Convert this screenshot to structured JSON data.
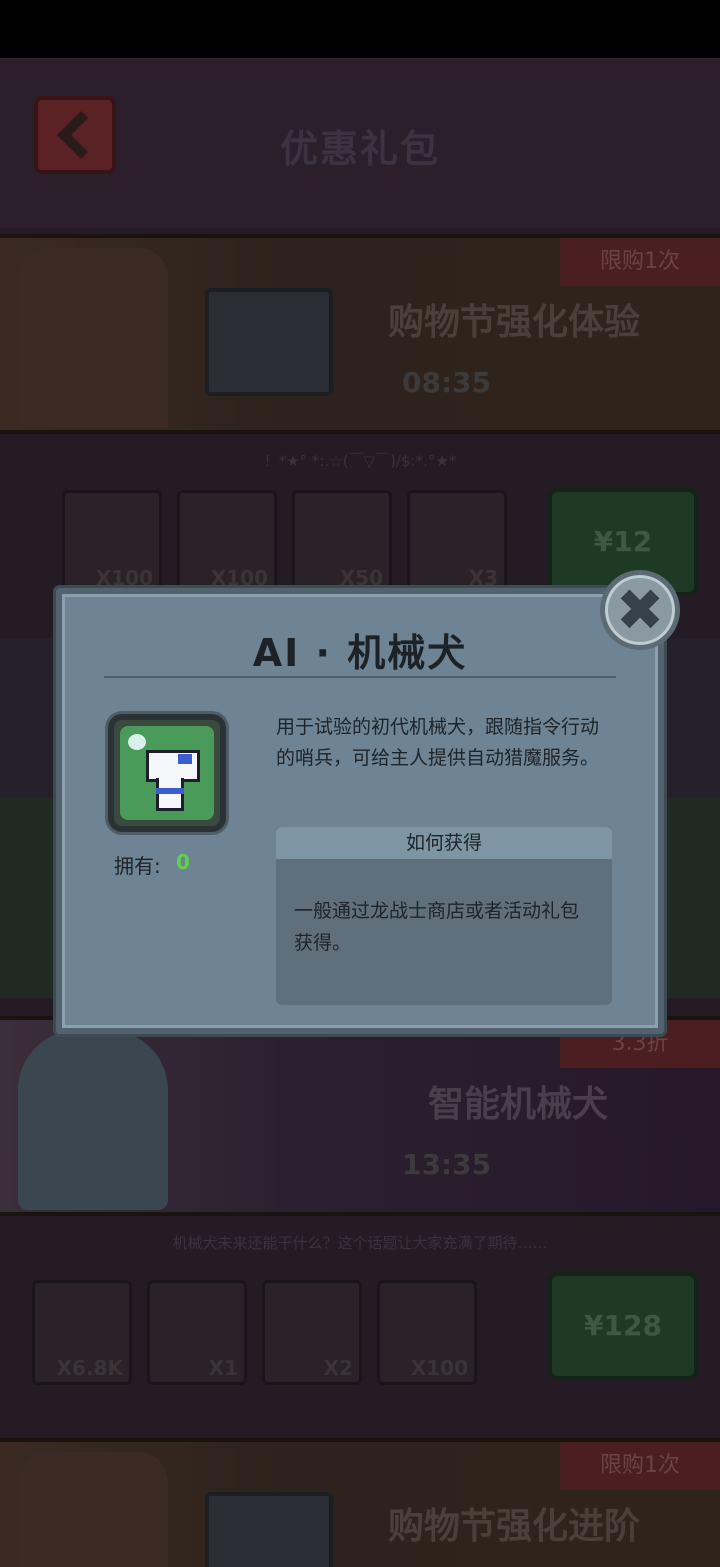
{
  "background": {
    "page_title": "优惠礼包",
    "banner1": {
      "tag": "限购1次",
      "title": "购物节强化体验",
      "timer": "08:35",
      "subtext": "！*★° *:.☆(￣▽￣)/$:*.°★*"
    },
    "row1": {
      "counts": [
        "X100",
        "X100",
        "X50",
        "X3"
      ],
      "price": "¥12"
    },
    "banner2": {
      "tag": "3.3折",
      "title": "智能机械犬",
      "timer": "13:35",
      "subtext": "机械犬未来还能干什么？这个话题让大家充满了期待……"
    },
    "row2": {
      "counts": [
        "X6.8K",
        "X1",
        "X2",
        "X100"
      ],
      "price": "¥128"
    },
    "banner3": {
      "tag": "限购1次",
      "title": "购物节强化进阶"
    }
  },
  "dialog": {
    "title": "AI · 机械犬",
    "description": "用于试验的初代机械犬，跟随指令行动的哨兵，可给主人提供自动猎魔服务。",
    "own_label": "拥有:",
    "own_value": "0",
    "how_to_get_header": "如何获得",
    "how_to_get_text": "一般通过龙战士商店或者活动礼包获得。",
    "close_icon": "close-x-icon"
  },
  "colors": {
    "dialog_bg": "#6e8394",
    "accent_green": "#5fd24a",
    "banner_tag": "#4b1e22"
  }
}
